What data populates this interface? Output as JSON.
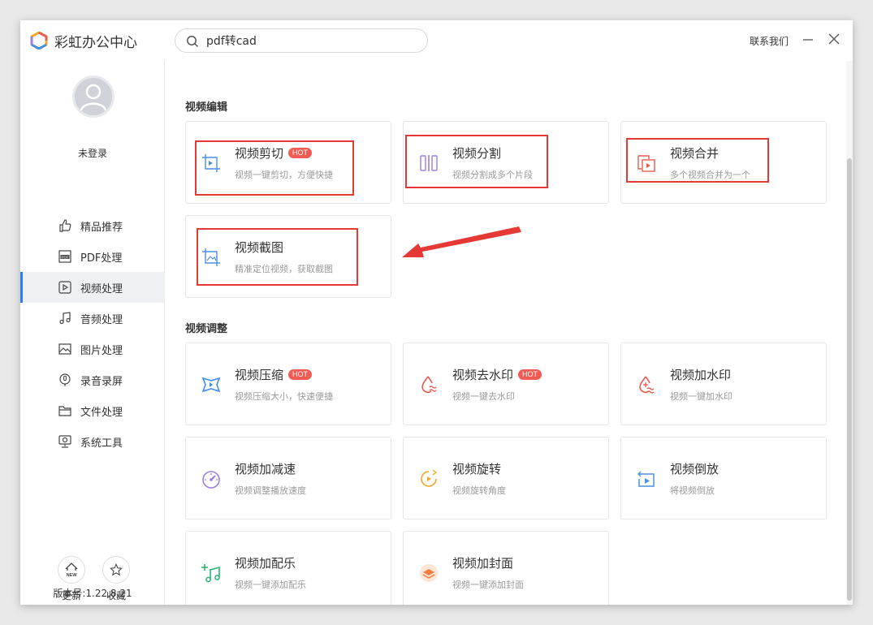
{
  "app": {
    "title": "彩虹办公中心"
  },
  "search": {
    "value": "pdf转cad"
  },
  "header": {
    "contact": "联系我们"
  },
  "user": {
    "login_label": "未登录"
  },
  "nav": [
    {
      "label": "精品推荐",
      "icon": "thumbs-up-icon"
    },
    {
      "label": "PDF处理",
      "icon": "pdf-icon"
    },
    {
      "label": "视频处理",
      "icon": "video-play-icon",
      "active": true
    },
    {
      "label": "音频处理",
      "icon": "music-note-icon"
    },
    {
      "label": "图片处理",
      "icon": "image-icon"
    },
    {
      "label": "录音录屏",
      "icon": "microphone-icon"
    },
    {
      "label": "文件处理",
      "icon": "folder-icon"
    },
    {
      "label": "系统工具",
      "icon": "system-tool-icon"
    }
  ],
  "bottom": {
    "update_label": "更新",
    "favorite_label": "收藏",
    "new_badge": "NEW",
    "version": "版本号:1.22.8.21"
  },
  "sections": [
    {
      "title": "视频编辑"
    },
    {
      "title": "视频调整"
    }
  ],
  "cards": [
    {
      "title": "视频剪切",
      "desc": "视频一键剪切，方便快捷",
      "hot": "HOT",
      "icon": "video-crop-icon",
      "color": "#4a90e2"
    },
    {
      "title": "视频分割",
      "desc": "视频分割成多个片段",
      "icon": "video-split-icon",
      "color": "#9b7ee6"
    },
    {
      "title": "视频合并",
      "desc": "多个视频合并为一个",
      "icon": "video-merge-icon",
      "color": "#e85a4f"
    },
    {
      "title": "视频截图",
      "desc": "精准定位视频，获取截图",
      "icon": "video-screenshot-icon",
      "color": "#4a90e2"
    },
    {
      "title": "视频压缩",
      "desc": "视频压缩大小，快速便捷",
      "hot": "HOT",
      "icon": "video-compress-icon",
      "color": "#3d8ef0"
    },
    {
      "title": "视频去水印",
      "desc": "视频一键去水印",
      "hot": "HOT",
      "icon": "remove-watermark-icon",
      "color": "#e85a4f"
    },
    {
      "title": "视频加水印",
      "desc": "视频一键加水印",
      "icon": "add-watermark-icon",
      "color": "#e85a4f"
    },
    {
      "title": "视频加减速",
      "desc": "视频调整播放速度",
      "icon": "speedometer-icon",
      "color": "#9b7ee6"
    },
    {
      "title": "视频旋转",
      "desc": "视频旋转角度",
      "icon": "rotate-icon",
      "color": "#f5a623"
    },
    {
      "title": "视频倒放",
      "desc": "将视频倒放",
      "icon": "reverse-play-icon",
      "color": "#4a90e2"
    },
    {
      "title": "视频加配乐",
      "desc": "视频一键添加配乐",
      "icon": "add-music-icon",
      "color": "#2bb673"
    },
    {
      "title": "视频加封面",
      "desc": "视频一键添加封面",
      "icon": "add-cover-icon",
      "color": "#f07c3e"
    }
  ]
}
